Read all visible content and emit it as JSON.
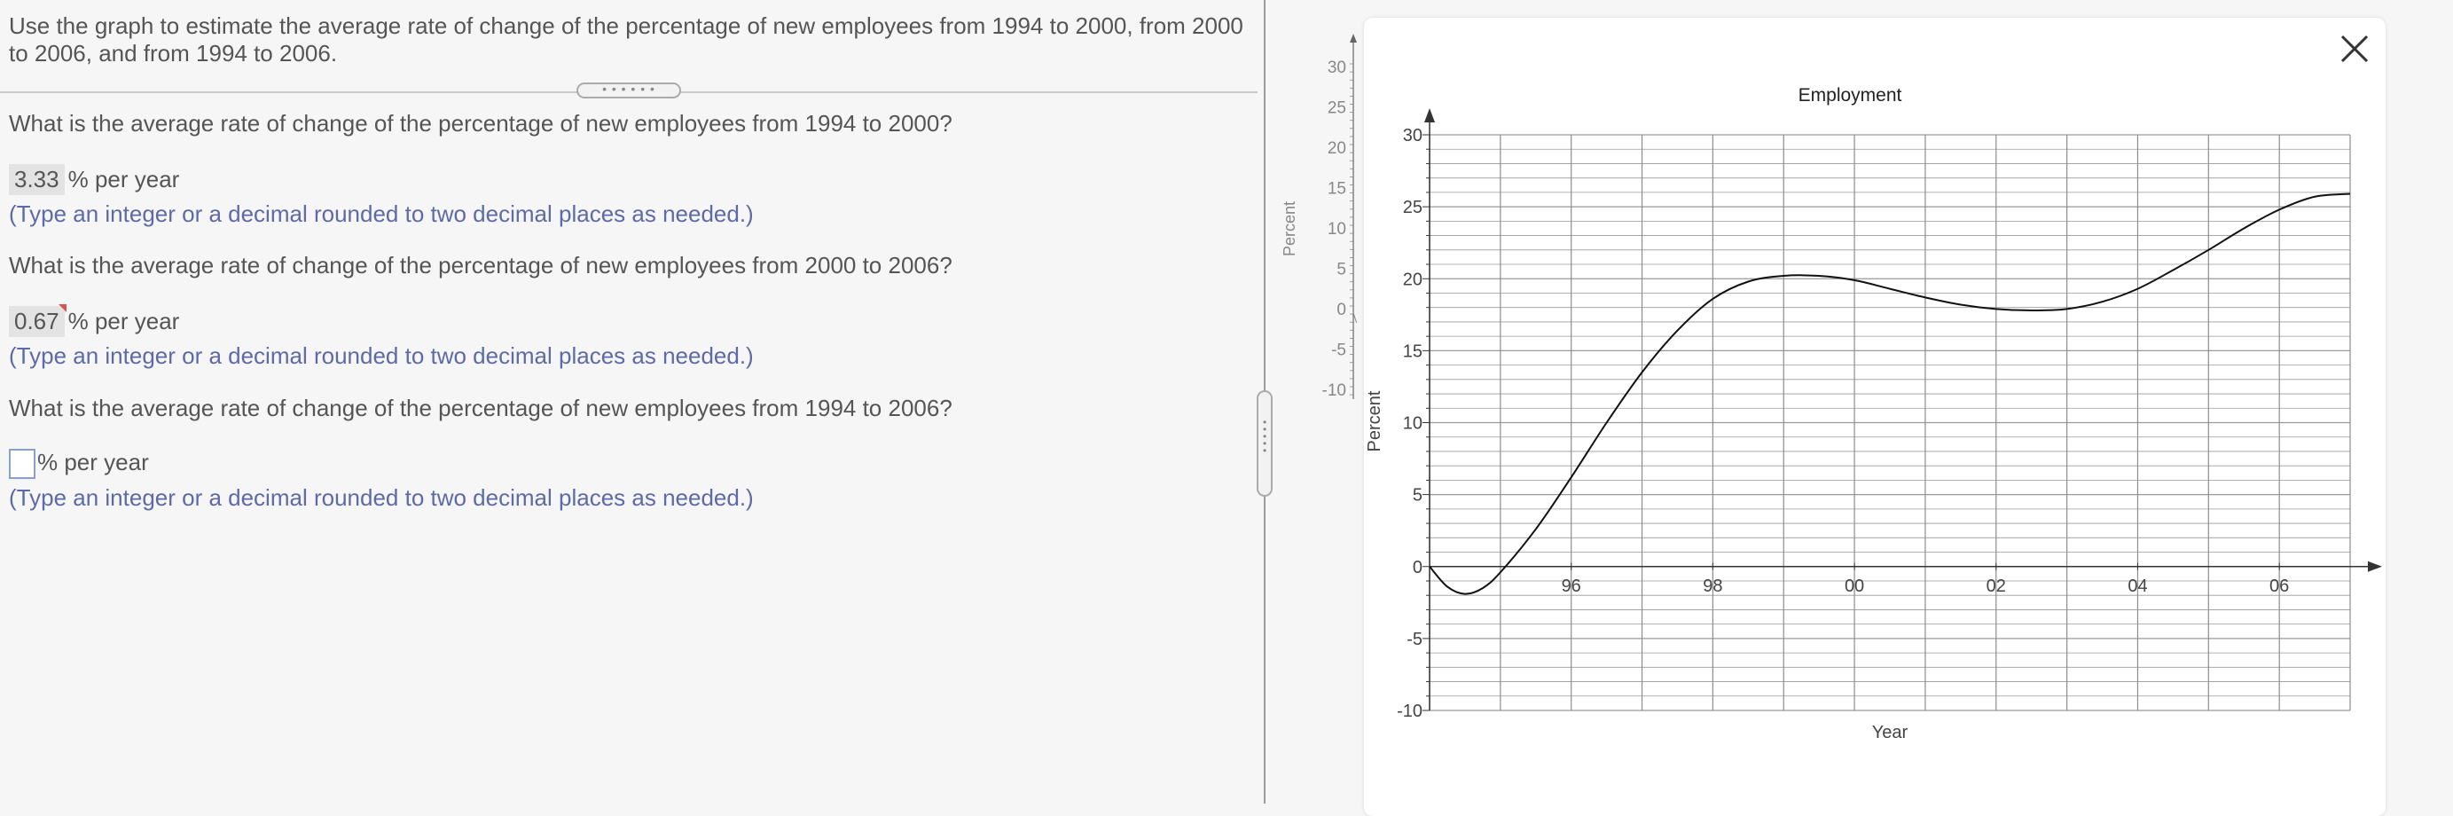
{
  "question": {
    "intro_line1": "Use the graph to estimate the average rate of change of the percentage of new employees from 1994 to 2000, from 2000",
    "intro_line2": "to 2006, and from 1994 to 2006.",
    "q1": "What is the average rate of change of the percentage of new employees from 1994 to 2000?",
    "q1_answer": "3.33",
    "q2": "What is the average rate of change of the percentage of new employees from 2000 to 2006?",
    "q2_answer": "0.67",
    "q3": "What is the average rate of change of the percentage of new employees from 1994 to 2006?",
    "q3_answer": "",
    "unit": "% per year",
    "hint": "(Type an integer or a decimal rounded to two decimal places as needed.)"
  },
  "thumbnail": {
    "ylabel": "Percent",
    "yticks": [
      "30",
      "25",
      "20",
      "15",
      "10",
      "5",
      "0",
      "-5",
      "-10"
    ]
  },
  "chart_data": {
    "type": "line",
    "title": "Employment",
    "xlabel": "Year",
    "ylabel": "Percent",
    "xlim": [
      1994,
      2007
    ],
    "ylim": [
      -10,
      30
    ],
    "x_ticks": [
      1996,
      1998,
      2000,
      2002,
      2004,
      2006
    ],
    "x_tick_labels": [
      "96",
      "98",
      "00",
      "02",
      "04",
      "06"
    ],
    "y_ticks": [
      -10,
      -5,
      0,
      5,
      10,
      15,
      20,
      25,
      30
    ],
    "y_tick_labels": [
      "-10",
      "-5",
      "0",
      "5",
      "10",
      "15",
      "20",
      "25",
      "30"
    ],
    "grid": true,
    "series": [
      {
        "x": [
          1994.0,
          1994.25,
          1994.5,
          1994.75,
          1995.0,
          1995.5,
          1996.0,
          1996.5,
          1997.0,
          1997.5,
          1998.0,
          1998.5,
          1999.0,
          1999.5,
          2000.0,
          2000.5,
          2001.0,
          2001.5,
          2002.0,
          2002.5,
          2003.0,
          2003.5,
          2004.0,
          2004.5,
          2005.0,
          2005.5,
          2006.0,
          2006.5,
          2007.0
        ],
        "y": [
          0.0,
          -1.4,
          -1.9,
          -1.5,
          -0.4,
          2.6,
          6.2,
          10.0,
          13.5,
          16.4,
          18.6,
          19.8,
          20.2,
          20.2,
          19.9,
          19.3,
          18.7,
          18.2,
          17.9,
          17.8,
          17.9,
          18.4,
          19.3,
          20.6,
          22.0,
          23.5,
          24.8,
          25.7,
          25.9
        ]
      }
    ]
  },
  "colors": {
    "hint_blue": "#5e6aa8",
    "text_gray": "#555555",
    "grid_gray": "#8c8c8c"
  }
}
